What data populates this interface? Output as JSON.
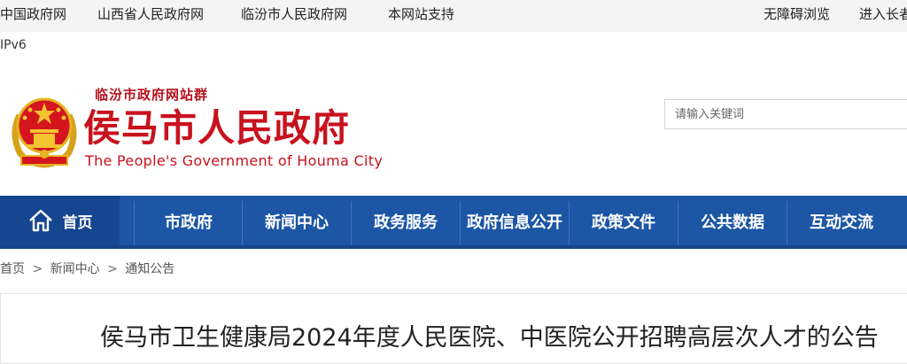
{
  "top_links": {
    "gov_cn": "中国政府网",
    "shanxi": "山西省人民政府网",
    "linfen": "临汾市人民政府网",
    "support": "本网站支持",
    "accessibility": "无障碍浏览",
    "elder_mode": "进入长者"
  },
  "ipv6": "IPv6",
  "header": {
    "site_group": "临汾市政府网站群",
    "title": "侯马市人民政府",
    "title_en": "The People's Government of Houma City"
  },
  "search": {
    "placeholder": "请输入关键词"
  },
  "nav": {
    "home": "首页",
    "items": [
      "市政府",
      "新闻中心",
      "政务服务",
      "政府信息公开",
      "政策文件",
      "公共数据",
      "互动交流"
    ]
  },
  "breadcrumb": {
    "home": "首页",
    "news": "新闻中心",
    "notices": "通知公告",
    "separator": ">"
  },
  "article": {
    "title": "侯马市卫生健康局2024年度人民医院、中医院公开招聘高层次人才的公告"
  },
  "colors": {
    "brand_red": "#c8121e",
    "nav_blue": "#1c56a5",
    "nav_home_blue": "#164690"
  },
  "icons": {
    "home": "home-icon",
    "emblem": "national-emblem-icon"
  }
}
